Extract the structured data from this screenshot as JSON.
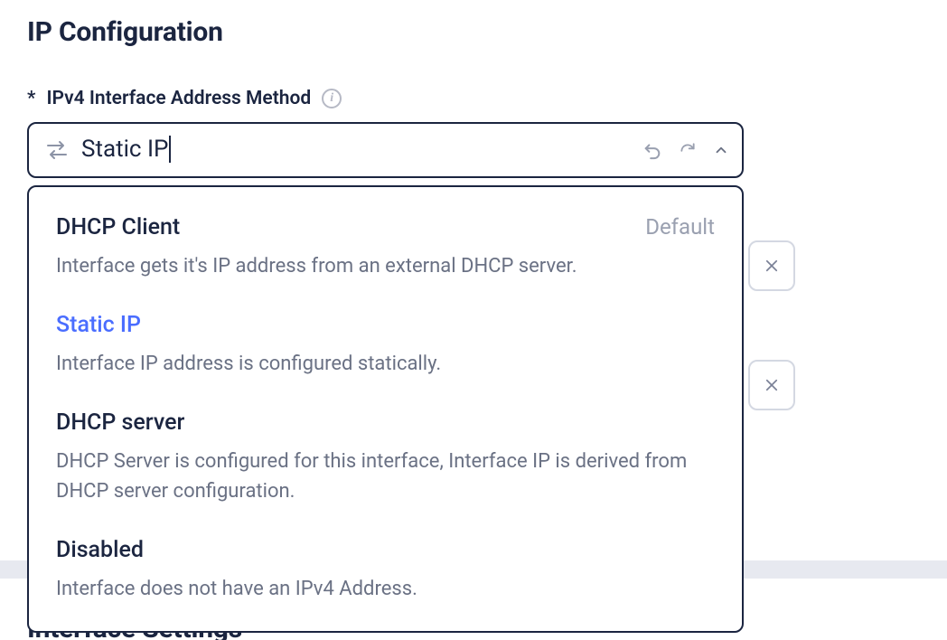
{
  "section": {
    "title": "IP Configuration"
  },
  "field": {
    "required_marker": "*",
    "label": "IPv4 Interface Address Method",
    "value": "Static IP"
  },
  "dropdown": {
    "options": [
      {
        "title": "DHCP Client",
        "description": "Interface gets it's IP address from an external DHCP server.",
        "default_label": "Default",
        "is_default": true,
        "selected": false
      },
      {
        "title": "Static IP",
        "description": "Interface IP address is configured statically.",
        "is_default": false,
        "selected": true
      },
      {
        "title": "DHCP server",
        "description": "DHCP Server is configured for this interface, Interface IP is derived from DHCP server configuration.",
        "is_default": false,
        "selected": false
      },
      {
        "title": "Disabled",
        "description": "Interface does not have an IPv4 Address.",
        "is_default": false,
        "selected": false
      }
    ]
  },
  "bg": {
    "next_section_title": "Interface Settings"
  },
  "icons": {
    "swap": "swap-icon",
    "info": "info-icon",
    "undo": "undo-icon",
    "refresh": "refresh-icon",
    "chevron_up": "chevron-up-icon",
    "close": "close-icon"
  }
}
